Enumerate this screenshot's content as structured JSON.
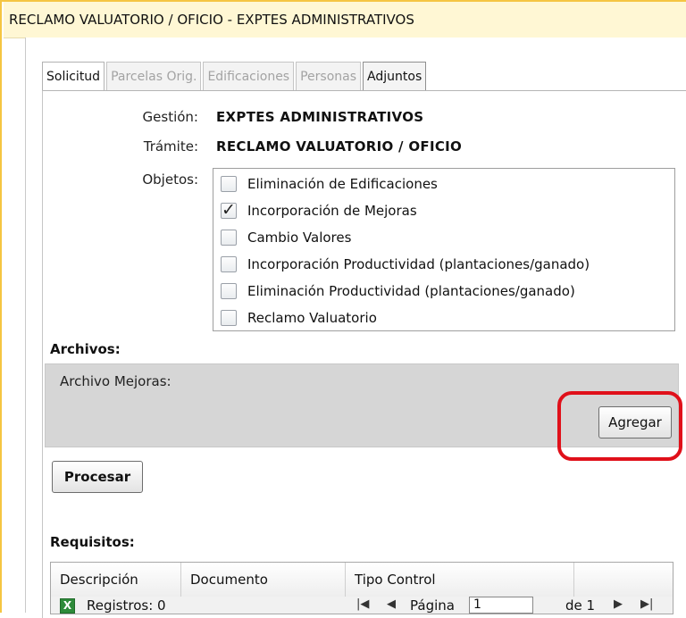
{
  "window": {
    "title": "RECLAMO VALUATORIO / OFICIO  -  EXPTES ADMINISTRATIVOS"
  },
  "tabs": [
    {
      "label": "Solicitud"
    },
    {
      "label": "Parcelas Orig."
    },
    {
      "label": "Edificaciones"
    },
    {
      "label": "Personas"
    },
    {
      "label": "Adjuntos"
    }
  ],
  "form": {
    "gestion_label": "Gestión:",
    "gestion_value": "EXPTES ADMINISTRATIVOS",
    "tramite_label": "Trámite:",
    "tramite_value": "RECLAMO VALUATORIO / OFICIO",
    "objetos_label": "Objetos:"
  },
  "objetos": [
    {
      "label": "Eliminación de Edificaciones",
      "checked": false
    },
    {
      "label": "Incorporación de Mejoras",
      "checked": true
    },
    {
      "label": "Cambio Valores",
      "checked": false
    },
    {
      "label": "Incorporación Productividad (plantaciones/ganado)",
      "checked": false
    },
    {
      "label": "Eliminación Productividad (plantaciones/ganado)",
      "checked": false
    },
    {
      "label": "Reclamo Valuatorio",
      "checked": false
    }
  ],
  "archivos": {
    "title": "Archivos:",
    "file_label": "Archivo Mejoras:",
    "add_button": "Agregar"
  },
  "procesar_button": "Procesar",
  "requisitos": {
    "title": "Requisitos:",
    "columns": [
      "Descripción",
      "Documento",
      "Tipo Control"
    ],
    "registros": "Registros: 0",
    "pagina_label": "Página",
    "page_value": "1",
    "de_label": "de 1"
  }
}
